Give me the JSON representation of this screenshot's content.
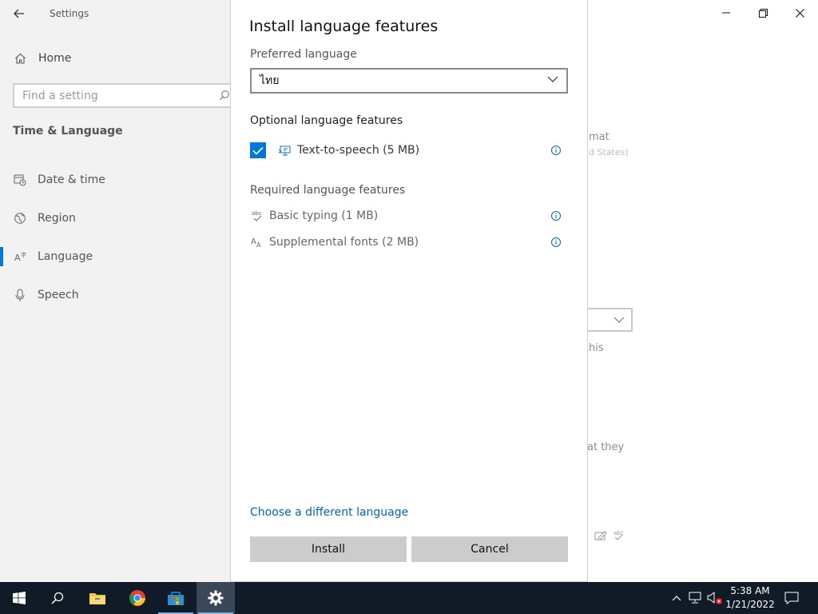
{
  "window": {
    "title": "Settings",
    "home_label": "Home",
    "search_placeholder": "Find a setting",
    "section_title": "Time & Language",
    "nav": [
      {
        "label": "Date & time",
        "icon": "calendar-clock-icon"
      },
      {
        "label": "Region",
        "icon": "globe-icon"
      },
      {
        "label": "Language",
        "icon": "language-icon",
        "active": true
      },
      {
        "label": "Speech",
        "icon": "microphone-icon"
      }
    ],
    "background_fragments": {
      "format": "mat",
      "format_sub": "d States)",
      "this": "his",
      "they": "at they"
    }
  },
  "dialog": {
    "title": "Install language features",
    "preferred_label": "Preferred language",
    "preferred_value": "ไทย",
    "optional_label": "Optional language features",
    "optional_features": [
      {
        "label": "Text-to-speech (5 MB)",
        "checked": true,
        "icon": "text-to-speech-icon"
      }
    ],
    "required_label": "Required language features",
    "required_features": [
      {
        "label": "Basic typing (1 MB)",
        "icon": "spellcheck-icon"
      },
      {
        "label": "Supplemental fonts (2 MB)",
        "icon": "fonts-icon"
      }
    ],
    "link": "Choose a different language",
    "install_label": "Install",
    "cancel_label": "Cancel"
  },
  "taskbar": {
    "apps": [
      "start",
      "search",
      "file-explorer",
      "chrome",
      "store",
      "settings"
    ],
    "time": "5:38 AM",
    "date": "1/21/2022"
  },
  "colors": {
    "accent": "#0078d7",
    "link": "#0068b8",
    "taskbar": "#101b27",
    "sidebar": "#f2f2f2",
    "button": "#cccccc"
  }
}
